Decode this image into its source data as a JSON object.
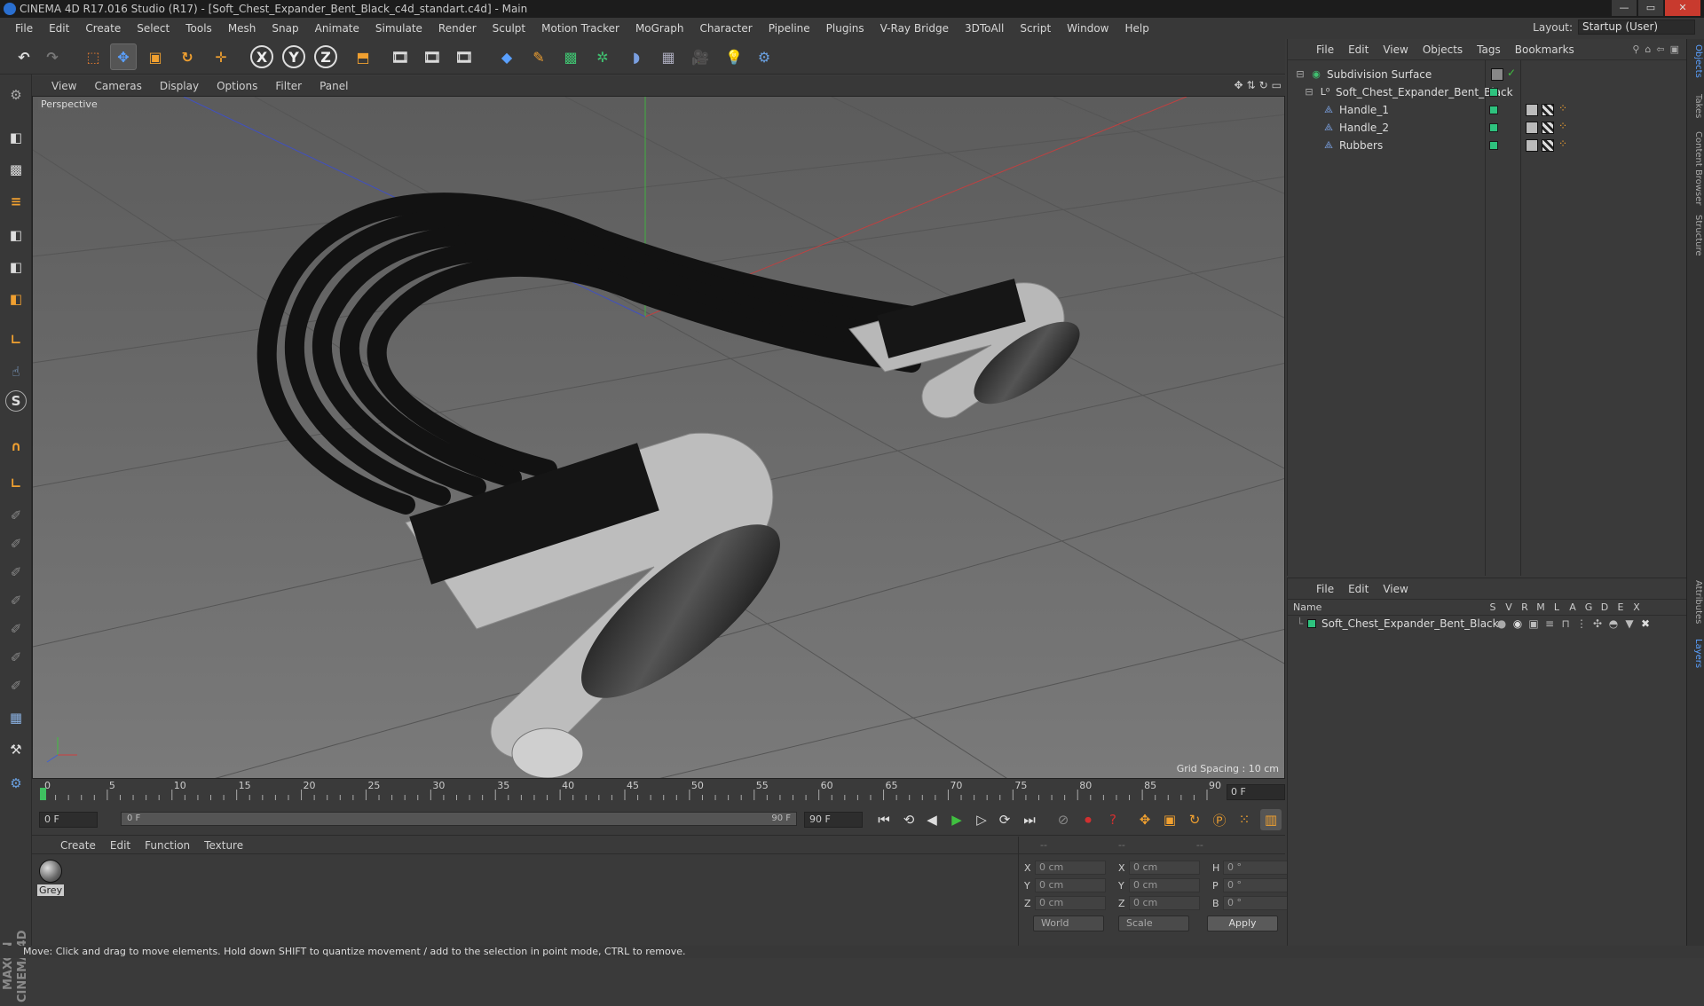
{
  "window": {
    "title": "CINEMA 4D R17.016 Studio (R17) - [Soft_Chest_Expander_Bent_Black_c4d_standart.c4d] - Main",
    "controls": [
      "—",
      "▭",
      "✕"
    ]
  },
  "menu": [
    "File",
    "Edit",
    "Create",
    "Select",
    "Tools",
    "Mesh",
    "Snap",
    "Animate",
    "Simulate",
    "Render",
    "Sculpt",
    "Motion Tracker",
    "MoGraph",
    "Character",
    "Pipeline",
    "Plugins",
    "V-Ray Bridge",
    "3DToAll",
    "Script",
    "Window",
    "Help"
  ],
  "layout": {
    "label": "Layout:",
    "value": "Startup (User)"
  },
  "toolbar": {
    "axis_x": "X",
    "axis_y": "Y",
    "axis_z": "Z"
  },
  "left_tools": [
    "S"
  ],
  "maxon_logo": "MAXON CINEMA 4D",
  "viewport": {
    "menu": [
      "View",
      "Cameras",
      "Display",
      "Options",
      "Filter",
      "Panel"
    ],
    "label": "Perspective",
    "grid_spacing": "Grid Spacing : 10 cm"
  },
  "timeline": {
    "ticks": [
      "0",
      "5",
      "10",
      "15",
      "20",
      "25",
      "30",
      "35",
      "40",
      "45",
      "50",
      "55",
      "60",
      "65",
      "70",
      "75",
      "80",
      "85",
      "90"
    ],
    "current_frame": "0 F"
  },
  "transport": {
    "start_frame": "0 F",
    "range_start": "0 F",
    "range_end": "90 F",
    "end_frame": "90 F"
  },
  "material_panel": {
    "menu": [
      "Create",
      "Edit",
      "Function",
      "Texture"
    ],
    "material_name": "Grey"
  },
  "coordinates": {
    "headers": [
      "--",
      "--",
      "--"
    ],
    "rows": [
      {
        "pos_label": "X",
        "pos": "0 cm",
        "size_label": "X",
        "size": "0 cm",
        "rot_label": "H",
        "rot": "0 °"
      },
      {
        "pos_label": "Y",
        "pos": "0 cm",
        "size_label": "Y",
        "size": "0 cm",
        "rot_label": "P",
        "rot": "0 °"
      },
      {
        "pos_label": "Z",
        "pos": "0 cm",
        "size_label": "Z",
        "size": "0 cm",
        "rot_label": "B",
        "rot": "0 °"
      }
    ],
    "mode": "World",
    "transform": "Scale",
    "apply": "Apply"
  },
  "object_manager": {
    "menu": [
      "File",
      "Edit",
      "View",
      "Objects",
      "Tags",
      "Bookmarks"
    ],
    "objects": [
      {
        "name": "Subdivision Surface",
        "indent": 0
      },
      {
        "name": "Soft_Chest_Expander_Bent_Black",
        "indent": 1
      },
      {
        "name": "Handle_1",
        "indent": 2
      },
      {
        "name": "Handle_2",
        "indent": 2
      },
      {
        "name": "Rubbers",
        "indent": 2
      }
    ]
  },
  "layer_manager": {
    "menu": [
      "File",
      "Edit",
      "View"
    ],
    "columns": [
      "Name",
      "S",
      "V",
      "R",
      "M",
      "L",
      "A",
      "G",
      "D",
      "E",
      "X"
    ],
    "layer_name": "Soft_Chest_Expander_Bent_Black",
    "layer_color": "#2ec27e"
  },
  "side_tabs": [
    "Objects",
    "Takes",
    "Content Browser",
    "Structure",
    "Attributes",
    "Layers"
  ],
  "status": "Move: Click and drag to move elements. Hold down SHIFT to quantize movement / add to the selection in point mode, CTRL to remove.",
  "colors": {
    "accent": "#3a7fd5",
    "object_green": "#2ec27e",
    "axis_x": "#d04040",
    "axis_y": "#40c040",
    "axis_z": "#4060d0"
  }
}
